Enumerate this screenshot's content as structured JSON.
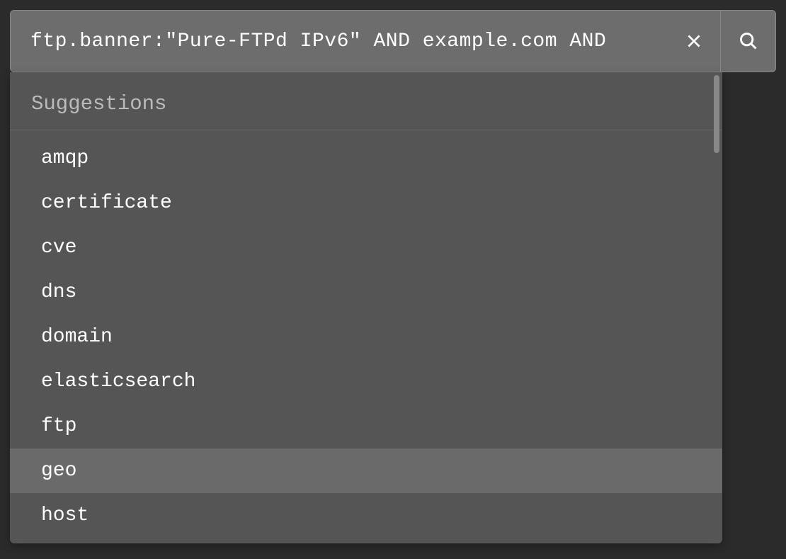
{
  "search": {
    "query": "ftp.banner:\"Pure-FTPd IPv6\" AND example.com AND"
  },
  "suggestions": {
    "header": "Suggestions",
    "items": [
      {
        "label": "amqp",
        "highlighted": false
      },
      {
        "label": "certificate",
        "highlighted": false
      },
      {
        "label": "cve",
        "highlighted": false
      },
      {
        "label": "dns",
        "highlighted": false
      },
      {
        "label": "domain",
        "highlighted": false
      },
      {
        "label": "elasticsearch",
        "highlighted": false
      },
      {
        "label": "ftp",
        "highlighted": false
      },
      {
        "label": "geo",
        "highlighted": true
      },
      {
        "label": "host",
        "highlighted": false
      }
    ]
  }
}
